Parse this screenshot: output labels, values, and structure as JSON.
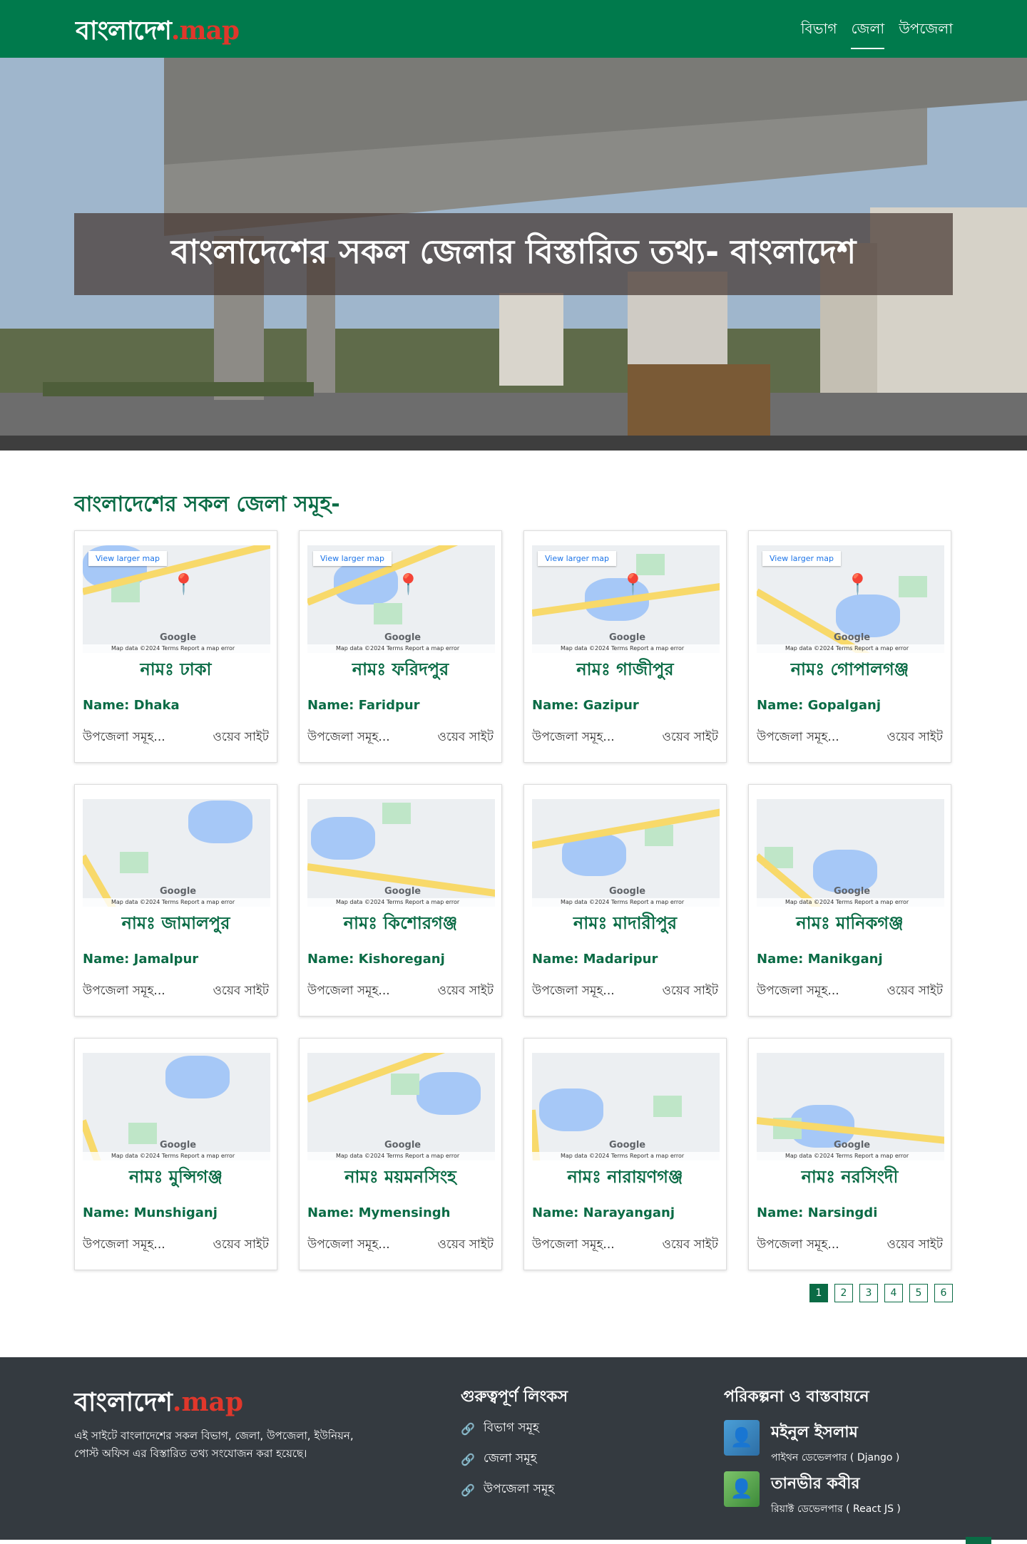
{
  "nav": {
    "logo_main": "বাংলাদেশ",
    "logo_suffix": ".map",
    "links": [
      "বিভাগ",
      "জেলা",
      "উপজেলা"
    ],
    "active_index": 1
  },
  "hero": {
    "title": "বাংলাদেশের সকল জেলার বিস্তারিত তথ্য- বাংলাদেশ"
  },
  "section": {
    "title": "বাংলাদেশের সকল জেলা সমূহ-"
  },
  "map_labels": {
    "view_larger": "View larger map",
    "google": "Google",
    "footer": "Map data ©2024   Terms   Report a map error"
  },
  "districts": [
    {
      "bn": "নামঃ ঢাকা",
      "en": "Name: Dhaka",
      "upazila": "উপজেলা সমূহ...",
      "web": "ওয়েব সাইট",
      "has_pin": true
    },
    {
      "bn": "নামঃ ফরিদপুর",
      "en": "Name: Faridpur",
      "upazila": "উপজেলা সমূহ...",
      "web": "ওয়েব সাইট",
      "has_pin": true
    },
    {
      "bn": "নামঃ গাজীপুর",
      "en": "Name: Gazipur",
      "upazila": "উপজেলা সমূহ...",
      "web": "ওয়েব সাইট",
      "has_pin": true
    },
    {
      "bn": "নামঃ গোপালগঞ্জ",
      "en": "Name: Gopalganj",
      "upazila": "উপজেলা সমূহ...",
      "web": "ওয়েব সাইট",
      "has_pin": true
    },
    {
      "bn": "নামঃ জামালপুর",
      "en": "Name: Jamalpur",
      "upazila": "উপজেলা সমূহ...",
      "web": "ওয়েব সাইট",
      "has_pin": false
    },
    {
      "bn": "নামঃ কিশোরগঞ্জ",
      "en": "Name: Kishoreganj",
      "upazila": "উপজেলা সমূহ...",
      "web": "ওয়েব সাইট",
      "has_pin": false
    },
    {
      "bn": "নামঃ মাদারীপুর",
      "en": "Name: Madaripur",
      "upazila": "উপজেলা সমূহ...",
      "web": "ওয়েব সাইট",
      "has_pin": false
    },
    {
      "bn": "নামঃ মানিকগঞ্জ",
      "en": "Name: Manikganj",
      "upazila": "উপজেলা সমূহ...",
      "web": "ওয়েব সাইট",
      "has_pin": false
    },
    {
      "bn": "নামঃ মুন্সিগঞ্জ",
      "en": "Name: Munshiganj",
      "upazila": "উপজেলা সমূহ...",
      "web": "ওয়েব সাইট",
      "has_pin": false
    },
    {
      "bn": "নামঃ ময়মনসিংহ",
      "en": "Name: Mymensingh",
      "upazila": "উপজেলা সমূহ...",
      "web": "ওয়েব সাইট",
      "has_pin": false
    },
    {
      "bn": "নামঃ নারায়ণগঞ্জ",
      "en": "Name: Narayanganj",
      "upazila": "উপজেলা সমূহ...",
      "web": "ওয়েব সাইট",
      "has_pin": false
    },
    {
      "bn": "নামঃ নরসিংদী",
      "en": "Name: Narsingdi",
      "upazila": "উপজেলা সমূহ...",
      "web": "ওয়েব সাইট",
      "has_pin": false
    }
  ],
  "pagination": {
    "pages": [
      "1",
      "2",
      "3",
      "4",
      "5",
      "6"
    ],
    "active": "1"
  },
  "footer": {
    "logo_main": "বাংলাদেশ",
    "logo_suffix": ".map",
    "description": "এই সাইটে বাংলাদেশের সকল বিভাগ, জেলা, উপজেলা, ইউনিয়ন, পোস্ট অফিস এর বিস্তারিত তথ্য সংযোজন করা হয়েছে।",
    "links_heading": "গুরুত্বপূর্ণ লিংকস",
    "links": [
      "বিভাগ সমূহ",
      "জেলা সমূহ",
      "উপজেলা সমূহ"
    ],
    "credits_heading": "পরিকল্পনা ও বাস্তবায়নে",
    "developers": [
      {
        "name": "মইনুল ইসলাম",
        "role": "পাইথন ডেভেলপার ( Django )"
      },
      {
        "name": "তানভীর কবীর",
        "role": "রিয়াক্ট ডেভেলপার ( React JS )"
      }
    ]
  },
  "colors": {
    "brand_green": "#007a4c",
    "heading_green": "#0a6b45",
    "footer_bg": "#343a40",
    "logo_accent": "#e0372b"
  }
}
